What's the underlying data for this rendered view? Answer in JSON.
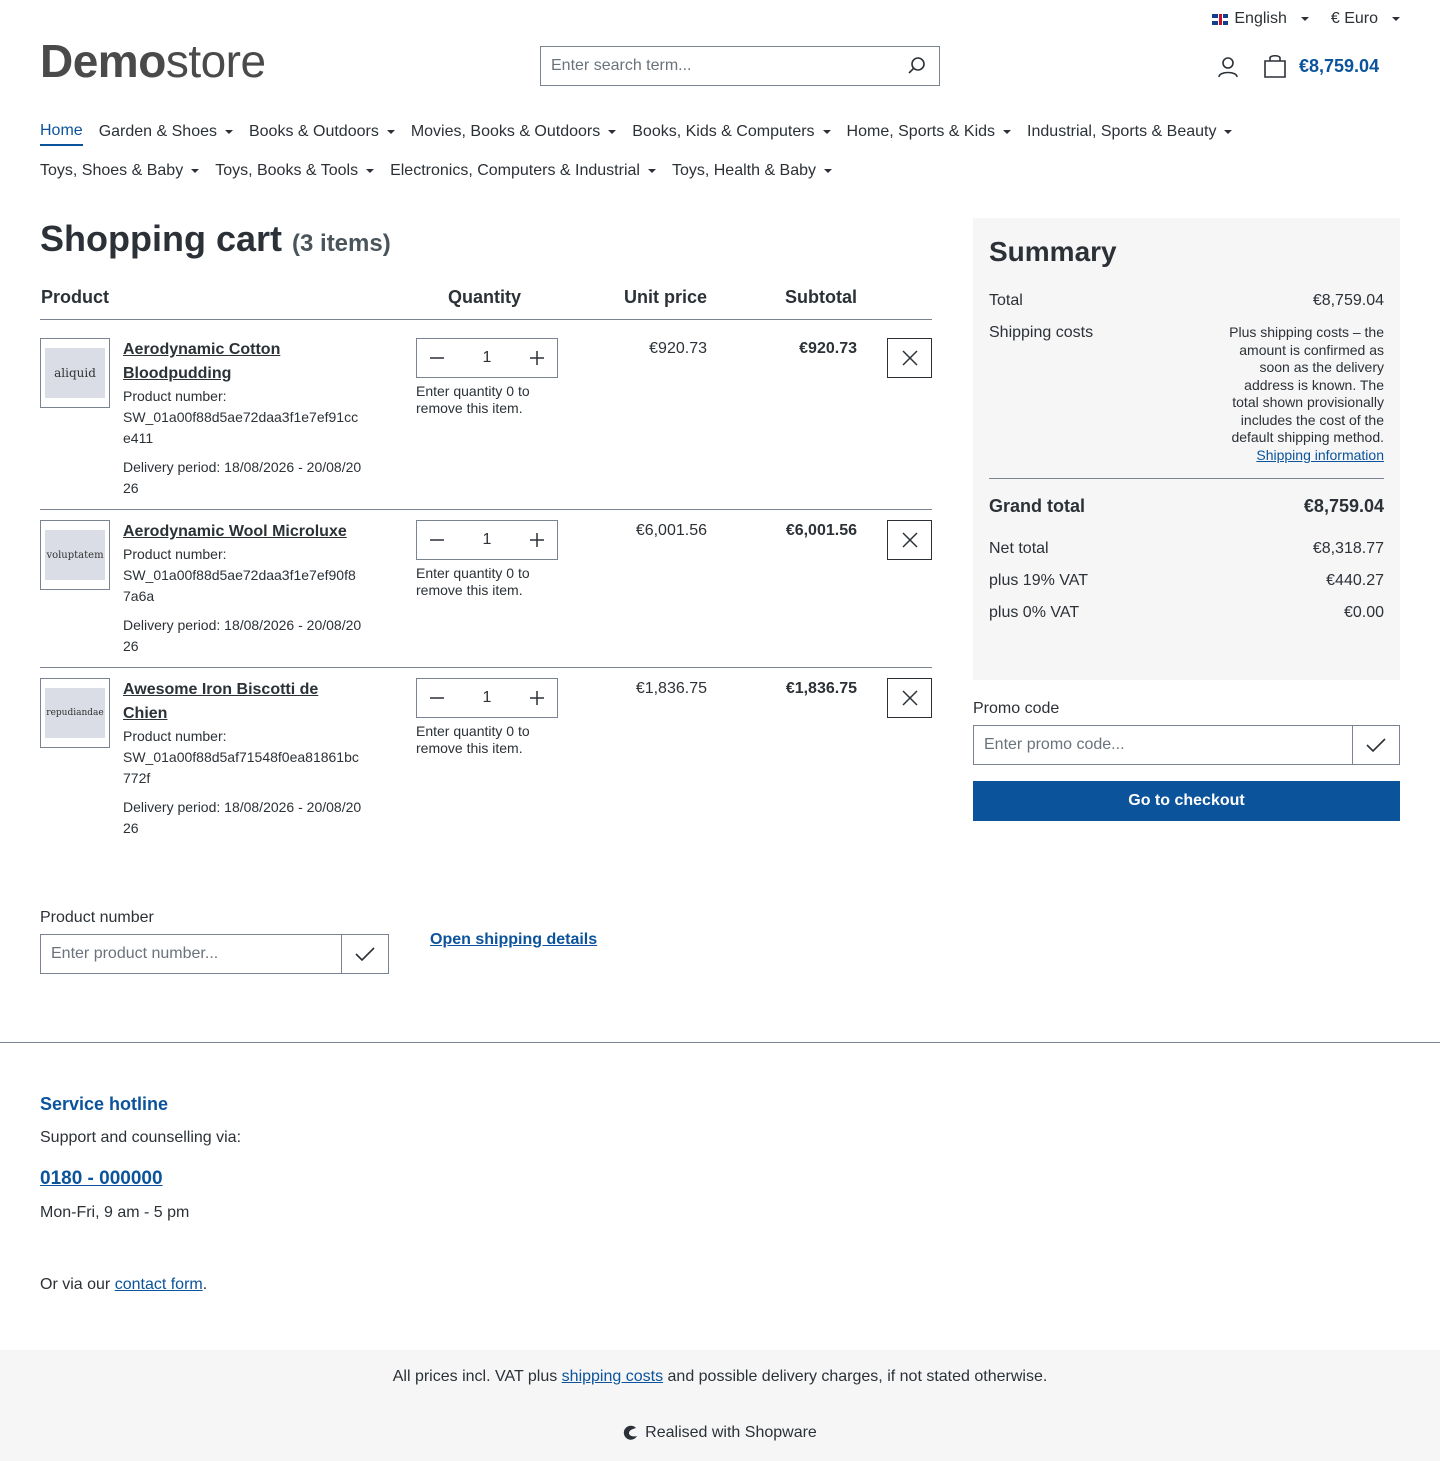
{
  "topbar": {
    "language": "English",
    "currency": "€ Euro"
  },
  "header": {
    "logo_bold": "Demo",
    "logo_light": "store",
    "search_placeholder": "Enter search term...",
    "cart_total": "€8,759.04"
  },
  "nav": {
    "row1": [
      "Home",
      "Garden & Shoes",
      "Books & Outdoors",
      "Movies, Books & Outdoors",
      "Books, Kids & Computers",
      "Home, Sports & Kids",
      "Industrial, Sports & Beauty"
    ],
    "row2": [
      "Toys, Shoes & Baby",
      "Toys, Books & Tools",
      "Electronics, Computers & Industrial",
      "Toys, Health & Baby"
    ]
  },
  "cart": {
    "title": "Shopping cart",
    "count": "(3 items)",
    "headers": {
      "product": "Product",
      "quantity": "Quantity",
      "unit_price": "Unit price",
      "subtotal": "Subtotal"
    },
    "qty_hint": "Enter quantity 0 to remove this item.",
    "items": [
      {
        "thumb": "aliquid",
        "name": "Aerodynamic Cotton Bloodpudding",
        "number_label": "Product number:",
        "number": "SW_01a00f88d5ae72daa3f1e7ef91cce411",
        "delivery": "Delivery period: 18/08/2026 - 20/08/2026",
        "qty": "1",
        "unit_price": "€920.73",
        "subtotal": "€920.73"
      },
      {
        "thumb": "voluptatem",
        "name": "Aerodynamic Wool Microluxe",
        "number_label": "Product number:",
        "number": "SW_01a00f88d5ae72daa3f1e7ef90f87a6a",
        "delivery": "Delivery period: 18/08/2026 - 20/08/2026",
        "qty": "1",
        "unit_price": "€6,001.56",
        "subtotal": "€6,001.56"
      },
      {
        "thumb": "repudiandae",
        "name": "Awesome Iron Biscotti de Chien",
        "number_label": "Product number:",
        "number": "SW_01a00f88d5af71548f0ea81861bc772f",
        "delivery": "Delivery period: 18/08/2026 - 20/08/2026",
        "qty": "1",
        "unit_price": "€1,836.75",
        "subtotal": "€1,836.75"
      }
    ]
  },
  "summary": {
    "title": "Summary",
    "total_label": "Total",
    "total": "€8,759.04",
    "shipping_label": "Shipping costs",
    "shipping_note": "Plus shipping costs – the amount is confirmed as soon as the delivery address is known. The total shown provisionally includes the cost of the default shipping method.",
    "shipping_link": "Shipping information",
    "grand_total_label": "Grand total",
    "grand_total": "€8,759.04",
    "net_label": "Net total",
    "net": "€8,318.77",
    "vat19_label": "plus 19% VAT",
    "vat19": "€440.27",
    "vat0_label": "plus 0% VAT",
    "vat0": "€0.00",
    "promo_label": "Promo code",
    "promo_placeholder": "Enter promo code...",
    "checkout": "Go to checkout"
  },
  "product_number": {
    "label": "Product number",
    "placeholder": "Enter product number...",
    "shipping_details": "Open shipping details"
  },
  "footer": {
    "hotline_title": "Service hotline",
    "support": "Support and counselling via:",
    "phone": "0180 - 000000",
    "hours": "Mon-Fri, 9 am - 5 pm",
    "contact_prefix": "Or via our",
    "contact_link": "contact form",
    "contact_suffix": ".",
    "vat_prefix": "All prices incl. VAT plus",
    "vat_link": "shipping costs",
    "vat_suffix": "and possible delivery charges, if not stated otherwise.",
    "realised": "Realised with Shopware"
  },
  "colors": {
    "accent": "#0b539b",
    "text": "#2b3136",
    "panel": "#f6f6f7"
  }
}
